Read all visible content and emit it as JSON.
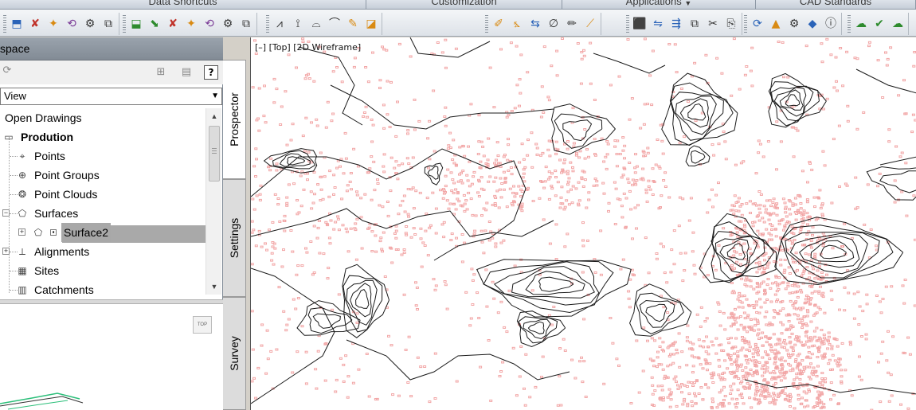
{
  "ribbon_panels": [
    {
      "title": "Data Shortcuts"
    },
    {
      "title": "Customization"
    },
    {
      "title": "Applications"
    },
    {
      "title": "CAD Standards"
    }
  ],
  "toolbar_groups": [
    {
      "name": "group-1",
      "buttons": [
        {
          "icon": "open-drawing-icon",
          "glyph": "⬒",
          "color": "blue"
        },
        {
          "icon": "data-shortcut-delete-icon",
          "glyph": "✘",
          "color": "red"
        },
        {
          "icon": "data-shortcut-new-icon",
          "glyph": "✦",
          "color": "orange"
        },
        {
          "icon": "sync-reference-icon",
          "glyph": "⟲",
          "color": "purple"
        },
        {
          "icon": "project-settings-icon",
          "glyph": "⚙",
          "color": "dark"
        },
        {
          "icon": "data-reference-icon",
          "glyph": "⧉",
          "color": "dark"
        }
      ]
    },
    {
      "name": "group-2",
      "buttons": [
        {
          "icon": "survey-query-icon",
          "glyph": "⬓",
          "color": "green"
        },
        {
          "icon": "survey-import-icon",
          "glyph": "⬊",
          "color": "green"
        },
        {
          "icon": "survey-delete-icon",
          "glyph": "✘",
          "color": "red"
        },
        {
          "icon": "survey-new-icon",
          "glyph": "✦",
          "color": "orange"
        },
        {
          "icon": "survey-network-icon",
          "glyph": "⟲",
          "color": "purple"
        },
        {
          "icon": "survey-settings-icon",
          "glyph": "⚙",
          "color": "dark"
        },
        {
          "icon": "survey-reference-icon",
          "glyph": "⧉",
          "color": "dark"
        }
      ]
    },
    {
      "name": "group-3",
      "buttons": [
        {
          "icon": "sketch-line-icon",
          "glyph": "⩘",
          "color": "dark"
        },
        {
          "icon": "sketch-tool-icon",
          "glyph": "⟟",
          "color": "dark"
        },
        {
          "icon": "base-line-icon",
          "glyph": "⌓",
          "color": "dark"
        },
        {
          "icon": "surface-tool-icon",
          "glyph": "⌒",
          "color": "dark"
        },
        {
          "icon": "sketch-edit-icon",
          "glyph": "✎",
          "color": "orange"
        },
        {
          "icon": "sketch-shape-icon",
          "glyph": "◪",
          "color": "orange"
        }
      ]
    },
    {
      "name": "group-4",
      "buttons": [
        {
          "icon": "pencil-new-icon",
          "glyph": "✐",
          "color": "orange"
        },
        {
          "icon": "ruler-icon",
          "glyph": "⦩",
          "color": "orange"
        },
        {
          "icon": "swap-arrows-icon",
          "glyph": "⇆",
          "color": "blue"
        },
        {
          "icon": "pipe-link-icon",
          "glyph": "∅",
          "color": "dark"
        },
        {
          "icon": "paint-icon",
          "glyph": "✏",
          "color": "dark"
        },
        {
          "icon": "brush-icon",
          "glyph": "⟋",
          "color": "orange"
        }
      ]
    },
    {
      "name": "group-5",
      "buttons": [
        {
          "icon": "insert-block-icon",
          "glyph": "⬛",
          "color": "orange"
        },
        {
          "icon": "compare-arrows-icon",
          "glyph": "⇋",
          "color": "blue"
        },
        {
          "icon": "html-export-icon",
          "glyph": "⇶",
          "color": "blue"
        },
        {
          "icon": "copy-sheet-icon",
          "glyph": "⧉",
          "color": "dark"
        },
        {
          "icon": "cut-icon",
          "glyph": "✂",
          "color": "dark"
        },
        {
          "icon": "paste-icon",
          "glyph": "⎘",
          "color": "dark"
        }
      ]
    },
    {
      "name": "group-6",
      "buttons": [
        {
          "icon": "refresh-icon",
          "glyph": "⟳",
          "color": "blue"
        },
        {
          "icon": "warning-icon",
          "glyph": "▲",
          "color": "orange"
        },
        {
          "icon": "check-standards-icon",
          "glyph": "⚙",
          "color": "dark"
        },
        {
          "icon": "layer-translate-icon",
          "glyph": "◆",
          "color": "blue"
        },
        {
          "icon": "info-icon",
          "glyph": "ⓘ",
          "color": "dark"
        }
      ]
    },
    {
      "name": "group-7",
      "buttons": [
        {
          "icon": "cloud-upload-icon",
          "glyph": "☁",
          "color": "green"
        },
        {
          "icon": "checkmark-icon",
          "glyph": "✔",
          "color": "green"
        },
        {
          "icon": "cloud-icon",
          "glyph": "☁",
          "color": "green"
        }
      ]
    }
  ],
  "palette": {
    "title": "space",
    "view_select": "View",
    "help_label": "?",
    "preview_chip": "TOP",
    "tree": [
      {
        "label": "Open Drawings",
        "icon": "",
        "bold": false
      },
      {
        "label": "Prodution",
        "icon": "drawing-icon",
        "bold": true
      },
      {
        "label": "Points",
        "icon": "points-icon",
        "bold": false
      },
      {
        "label": "Point Groups",
        "icon": "point-groups-icon",
        "bold": false
      },
      {
        "label": "Point Clouds",
        "icon": "point-clouds-icon",
        "bold": false
      },
      {
        "label": "Surfaces",
        "icon": "surfaces-icon",
        "bold": false
      },
      {
        "label": "Surface2",
        "icon": "surface-icon",
        "bold": false,
        "selected": true
      },
      {
        "label": "Alignments",
        "icon": "alignments-icon",
        "bold": false
      },
      {
        "label": "Sites",
        "icon": "sites-icon",
        "bold": false
      },
      {
        "label": "Catchments",
        "icon": "catchments-icon",
        "bold": false
      }
    ]
  },
  "tabs": [
    {
      "label": "Prospector",
      "active": true
    },
    {
      "label": "Settings",
      "active": false
    },
    {
      "label": "Survey",
      "active": false
    }
  ],
  "viewport": {
    "label": "[–] [Top] [2D Wireframe]"
  },
  "colors": {
    "contour": "#1a1a1a",
    "points": "#f2a6a6",
    "selection": "#a9a9a9"
  }
}
